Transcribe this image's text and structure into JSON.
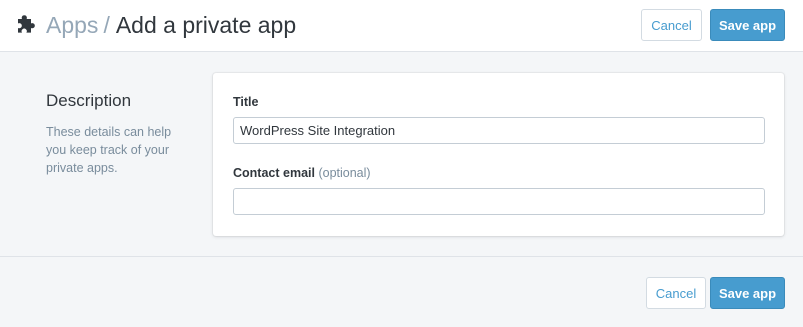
{
  "header": {
    "icon": "puzzle-piece-icon",
    "breadcrumb_parent": "Apps",
    "breadcrumb_separator": "/",
    "breadcrumb_current": "Add a private app",
    "cancel_label": "Cancel",
    "save_label": "Save app"
  },
  "description": {
    "title": "Description",
    "text": "These details can help you keep track of your private apps."
  },
  "form": {
    "title_label": "Title",
    "title_value": "WordPress Site Integration",
    "email_label": "Contact email",
    "email_optional": "(optional)",
    "email_value": ""
  },
  "footer": {
    "cancel_label": "Cancel",
    "save_label": "Save app"
  },
  "colors": {
    "accent": "#479ccf",
    "muted_text": "#798c9c",
    "background": "#f4f6f8"
  }
}
